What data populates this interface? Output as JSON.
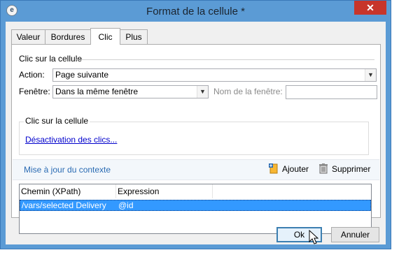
{
  "window": {
    "title": "Format de la cellule *",
    "close_glyph": "✕",
    "app_icon_glyph": "e"
  },
  "tabs": [
    {
      "label": "Valeur",
      "active": false
    },
    {
      "label": "Bordures",
      "active": false
    },
    {
      "label": "Clic",
      "active": true
    },
    {
      "label": "Plus",
      "active": false
    }
  ],
  "click_group": {
    "label": "Clic sur la cellule",
    "action_label": "Action:",
    "action_value": "Page suivante",
    "window_label": "Fenêtre:",
    "window_value": "Dans la même fenêtre",
    "window_name_label": "Nom de la fenêtre:",
    "window_name_value": ""
  },
  "sub_group": {
    "label": "Clic sur la cellule",
    "link": "Désactivation des clics..."
  },
  "context": {
    "title": "Mise à jour du contexte",
    "add_label": "Ajouter",
    "delete_label": "Supprimer"
  },
  "table": {
    "columns": [
      "Chemin (XPath)",
      "Expression"
    ],
    "rows": [
      {
        "path": "/vars/selected Delivery",
        "expression": "@id",
        "selected": true
      }
    ]
  },
  "buttons": {
    "ok": "Ok",
    "cancel": "Annuler"
  },
  "colors": {
    "title_bar": "#5b9bd5",
    "close_button": "#c7352b",
    "selection": "#3399ff",
    "link": "#0000cc",
    "context_title": "#2a6bb3"
  }
}
